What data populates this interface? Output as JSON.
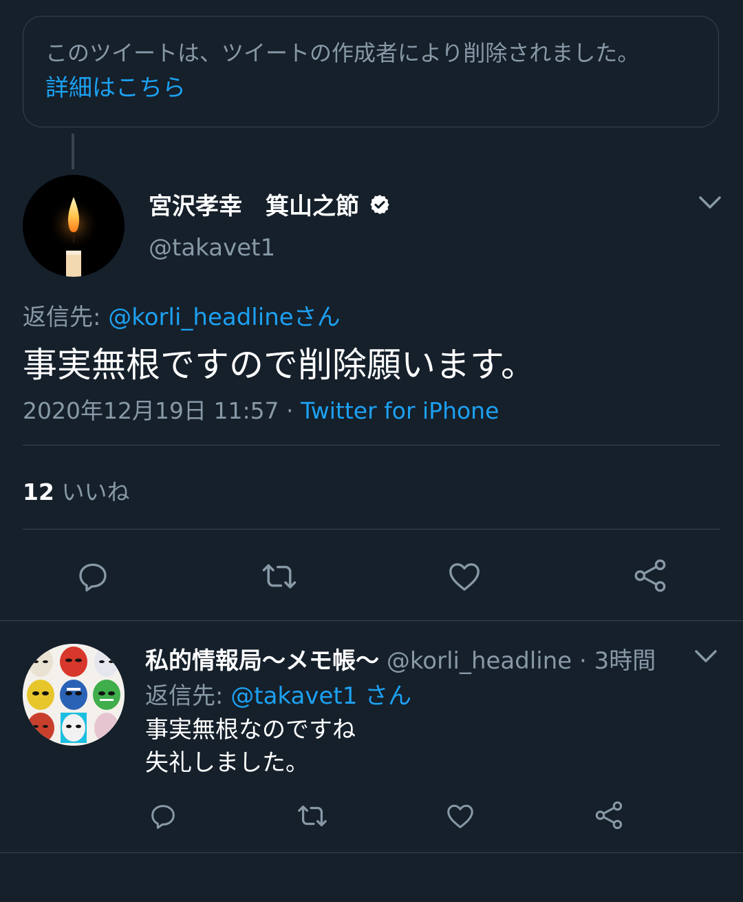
{
  "deleted_notice": {
    "text": "このツイートは、ツイートの作成者により削除されました。",
    "link_label": "詳細はこちら"
  },
  "main_tweet": {
    "display_name": "宮沢孝幸　箕山之節",
    "handle": "@takavet1",
    "reply_prefix": "返信先: ",
    "reply_to": "@korli_headline",
    "reply_suffix": "さん",
    "text": "事実無根ですので削除願います。",
    "timestamp": "2020年12月19日 11:57",
    "separator": " · ",
    "source": "Twitter for iPhone",
    "like_count": "12",
    "like_label": "いいね"
  },
  "reply_tweet": {
    "display_name": "私的情報局〜メモ帳〜",
    "handle": "@korli_headline",
    "separator": " · ",
    "time": "3時間",
    "reply_prefix": "返信先: ",
    "reply_to": "@takavet1",
    "reply_suffix": " さん",
    "text_line1": "事実無根なのですね",
    "text_line2": "失礼しました。"
  },
  "icons": [
    "reply-icon",
    "retweet-icon",
    "like-icon",
    "share-icon",
    "chevron-down-icon",
    "verified-badge-icon"
  ],
  "colors": {
    "background": "#15202b",
    "link": "#1da1f2",
    "muted": "#8899a6",
    "border": "#38444d"
  }
}
